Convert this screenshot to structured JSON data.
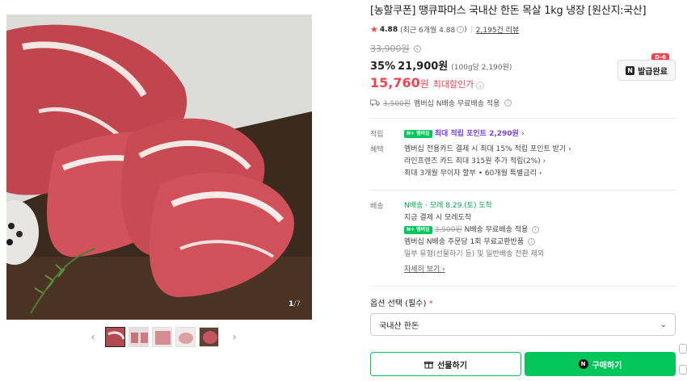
{
  "product": {
    "title": "[농할쿠폰] 땡큐파머스 국내산 한돈 목살 1kg 냉장 [원산지:국산]",
    "rating": "4.88",
    "rating_recent": "(최근 6개월 4.88",
    "rating_recent_close": ")",
    "reviews": "2,195건 리뷰",
    "original_price": "33,900원",
    "discount_rate": "35%",
    "sale_price": "21,900원",
    "unit_price": "(100g당 2,190원)",
    "max_discount_price": "15,760",
    "max_discount_won": "원",
    "max_discount_label": "최대할인가"
  },
  "coupon": {
    "badge": "D-6",
    "label": "발급완료",
    "icon": "N"
  },
  "shipping_summary": {
    "strike": "3,500원",
    "text": "멤버십 N배송 무료배송 적용"
  },
  "benefits": {
    "points_key": "적립",
    "points_badge": "N+ 멤버십",
    "points_text": "최대 적립 포인트 2,290원 ›",
    "perks_key": "혜택",
    "perks": [
      "멤버십 전용카드 결제 시 최대 15% 적립 포인트 받기 ›",
      "라인프렌즈 카드 최대 315원 추가 적립(2%) ›",
      "최대 3개월 무이자 할부 • 60개월 특별금리 ›"
    ]
  },
  "delivery": {
    "key": "배송",
    "eta": "N배송 · 모레 8.29.(토) 도착",
    "order_note": "지금 결제 시 모레도착",
    "npay_badge": "N+ 멤버십",
    "free_strike": "3,500원",
    "free_text": "N배송 무료배송 적용",
    "exchange": "멤버십 N배송 주문당 1회 무료교환반품",
    "exclusion": "일부 유형(선물하기 등) 및 일반배송 전환 제외",
    "details_link": "자세히 보기 ›"
  },
  "options": {
    "label": "옵션 선택 (필수)",
    "required_mark": "*",
    "selected": "국내산 한돈"
  },
  "actions": {
    "gift": "선물하기",
    "buy": "구매하기",
    "buy_icon": "N"
  },
  "gallery": {
    "current": "1",
    "total": "/7"
  },
  "colors": {
    "brand_green": "#03c75a",
    "price_red": "#f04452",
    "point_purple": "#7a3fdb"
  },
  "icons": [
    "star-icon",
    "info-icon",
    "truck-icon",
    "chevron-down-icon",
    "gift-icon",
    "naver-n-icon",
    "chevron-left-icon",
    "chevron-right-icon"
  ]
}
